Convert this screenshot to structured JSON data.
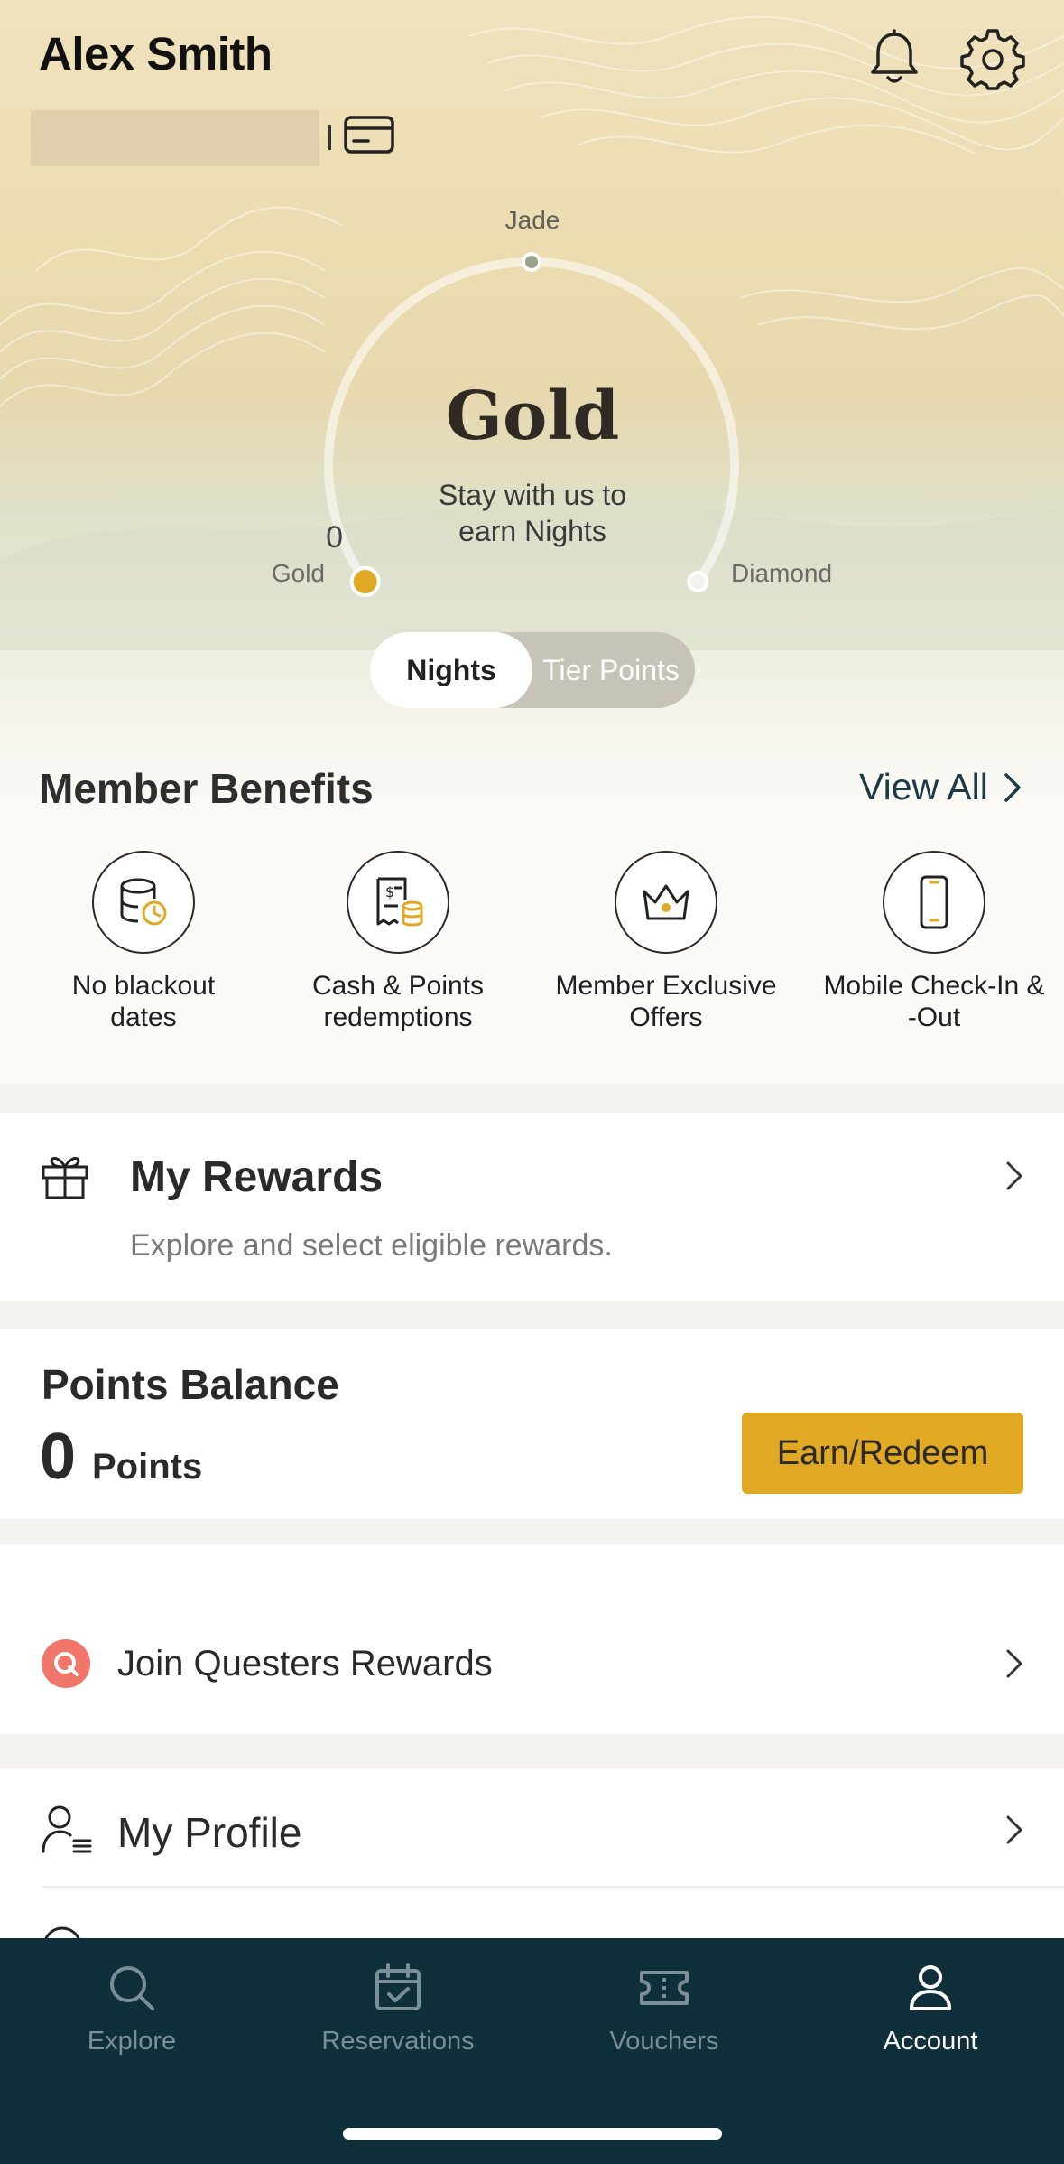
{
  "header": {
    "user_name": "Alex Smith",
    "member_number": ""
  },
  "tier": {
    "current": "Gold",
    "subtitle_line1": "Stay with us to",
    "subtitle_line2": "earn Nights",
    "nights": "0",
    "start_label": "Gold",
    "mid_label": "Jade",
    "end_label": "Diamond",
    "progress": 0
  },
  "toggle": {
    "active": "Nights",
    "inactive": "Tier Points"
  },
  "benefits": {
    "title": "Member Benefits",
    "view_all": "View All",
    "items": [
      {
        "line1": "No blackout",
        "line2": "dates",
        "icon": "database-clock-icon"
      },
      {
        "line1": "Cash & Points",
        "line2": "redemptions",
        "icon": "receipt-coins-icon"
      },
      {
        "line1": "Member Exclusive",
        "line2": "Offers",
        "icon": "crown-icon"
      },
      {
        "line1": "Mobile Check-In &",
        "line2": "-Out",
        "icon": "mobile-phone-icon"
      }
    ]
  },
  "rewards": {
    "title": "My Rewards",
    "description": "Explore and select eligible rewards."
  },
  "points": {
    "title": "Points Balance",
    "value": "0",
    "unit": "Points",
    "button": "Earn/Redeem"
  },
  "questers": {
    "title": "Join Questers Rewards"
  },
  "profile": {
    "title": "My Profile"
  },
  "tabbar": {
    "items": [
      {
        "label": "Explore",
        "icon": "search-icon"
      },
      {
        "label": "Reservations",
        "icon": "calendar-check-icon"
      },
      {
        "label": "Vouchers",
        "icon": "ticket-icon"
      },
      {
        "label": "Account",
        "icon": "person-icon"
      }
    ],
    "active": "Account"
  },
  "colors": {
    "accent_gold": "#e0a823",
    "tabbar_bg": "#0f2f3b",
    "jade_dot": "#9aa58a",
    "link": "#1c3a46",
    "questers_badge": "#ef7668"
  }
}
